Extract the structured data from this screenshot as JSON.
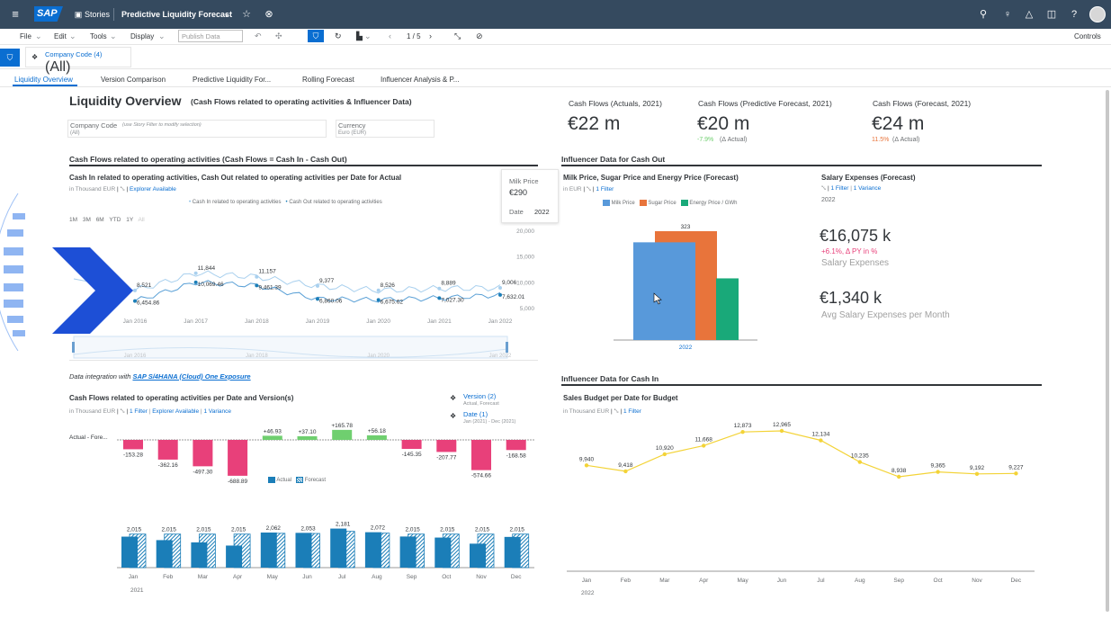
{
  "shell": {
    "logo": "SAP",
    "stories": "Stories",
    "story_title": "Predictive Liquidity Forecast"
  },
  "toolbar": {
    "file": "File",
    "edit": "Edit",
    "tools": "Tools",
    "display": "Display",
    "publish": "Publish Data",
    "page": "1 / 5",
    "controls": "Controls"
  },
  "filter": {
    "label": "Company Code (4)",
    "value": "(All)"
  },
  "tabs": [
    "Liquidity Overview",
    "Version Comparison",
    "Predictive Liquidity For...",
    "Rolling Forecast",
    "Influencer Analysis & P..."
  ],
  "page": {
    "title": "Liquidity Overview",
    "subtitle": "(Cash Flows related to operating activities & Influencer Data)",
    "company_code_label": "Company Code",
    "company_code_hint": "(use Story Filter to modify selection)",
    "company_code_value": "(All)",
    "currency_label": "Currency",
    "currency_value": "Euro (EUR)"
  },
  "kpis": [
    {
      "label": "Cash Flows (Actuals, 2021)",
      "value": "€22 m",
      "delta": "",
      "delta_label": ""
    },
    {
      "label": "Cash Flows (Predictive Forecast, 2021)",
      "value": "€20 m",
      "delta": "-7.9%",
      "delta_label": "(Δ Actual)"
    },
    {
      "label": "Cash Flows (Forecast, 2021)",
      "value": "€24 m",
      "delta": "11.5%",
      "delta_label": "(Δ Actual)"
    }
  ],
  "sections": {
    "cashflows": "Cash Flows related to operating activities (Cash Flows = Cash In - Cash Out)",
    "influencer_out": "Influencer Data for Cash Out",
    "influencer_in": "Influencer Data for Cash In"
  },
  "line_widget": {
    "title": "Cash In related to operating activities, Cash Out related to operating activities per Date for Actual",
    "sub_unit": "in Thousand EUR",
    "sub_link": "Explorer Available",
    "legend": [
      "Cash In related to operating activities",
      "Cash Out related to operating activities"
    ],
    "ranges": [
      "1M",
      "3M",
      "6M",
      "YTD",
      "1Y",
      "All"
    ],
    "tooltip": {
      "label1": "Milk Price",
      "value1": "€290",
      "label2": "Date",
      "value2": "2022"
    },
    "x_labels": [
      "Jan 2016",
      "Jan 2017",
      "Jan 2018",
      "Jan 2019",
      "Jan 2020",
      "Jan 2021",
      "Jan 2022"
    ],
    "y_labels": [
      "20,000",
      "15,000",
      "10,000",
      "5,000"
    ],
    "data_labels_in": [
      "8,521",
      "11,844",
      "11,157",
      "9,377",
      "8,526",
      "8,889",
      "9,006"
    ],
    "data_labels_out": [
      "6,454.86",
      "10,069.46",
      "9,461.39",
      "6,860.06",
      "6,675.62",
      "7,027.30",
      "7,632.01"
    ]
  },
  "integration": {
    "text": "Data integration with",
    "link": "SAP S/4HANA (Cloud) One Exposure"
  },
  "waterfall": {
    "title": "Cash Flows related to operating activities per Date and Version(s)",
    "sub_unit": "in Thousand EUR",
    "sub_filter": "1 Filter",
    "sub_explorer": "Explorer Available",
    "sub_variance": "1 Variance",
    "row_label": "Actual - Fore...",
    "version_label": "Version (2)",
    "version_value": "Actual, Forecast",
    "date_label": "Date (1)",
    "date_value": "Jan (2021) - Dec (2021)",
    "legend": [
      "Actual",
      "Forecast"
    ],
    "year": "2021"
  },
  "chart_data": [
    {
      "type": "line",
      "title": "Cash In related to operating activities, Cash Out related to operating activities per Date for Actual",
      "x": [
        "2016",
        "2017",
        "2018",
        "2019",
        "2020",
        "2021",
        "2022"
      ],
      "series": [
        {
          "name": "Cash In related to operating activities",
          "values": [
            8521,
            11844,
            11157,
            9377,
            8526,
            8889,
            9006
          ]
        },
        {
          "name": "Cash Out related to operating activities",
          "values": [
            6454.86,
            10069.46,
            9461.39,
            6860.06,
            6675.62,
            7027.3,
            7632.01
          ]
        }
      ],
      "ylim": [
        5000,
        20000
      ]
    },
    {
      "type": "bar",
      "title": "Cash Flows related to operating activities per Date and Version(s)",
      "categories": [
        "Jan",
        "Feb",
        "Mar",
        "Apr",
        "May",
        "Jun",
        "Jul",
        "Aug",
        "Sep",
        "Oct",
        "Nov",
        "Dec"
      ],
      "variance": [
        -153.28,
        -362.16,
        -497.3,
        -688.89,
        46.93,
        37.1,
        165.78,
        56.18,
        -145.35,
        -207.77,
        -574.66,
        -168.58
      ],
      "variance_labels": [
        "-153.28",
        "-362.16",
        "-497.30",
        "-688.89",
        "+46.93",
        "+37.10",
        "+165.78",
        "+56.18",
        "-145.35",
        "-207.77",
        "-574.66",
        "-168.58"
      ],
      "series": [
        {
          "name": "Actual",
          "values": [
            1862,
            1653,
            1518,
            1326,
            2109,
            2090,
            2347,
            2128,
            1870,
            1807,
            1440,
            1846
          ]
        },
        {
          "name": "Forecast",
          "values": [
            2015,
            2015,
            2015,
            2015,
            2062,
            2053,
            2181,
            2072,
            2015,
            2015,
            2015,
            2015
          ]
        }
      ],
      "top_labels": [
        "2,015",
        "2,015",
        "2,015",
        "2,015",
        "2,062",
        "2,053",
        "2,181",
        "2,072",
        "2,015",
        "2,015",
        "2,015",
        "2,015"
      ]
    },
    {
      "type": "bar",
      "title": "Milk Price, Sugar Price and Energy Price (Forecast)",
      "categories": [
        "2022"
      ],
      "series": [
        {
          "name": "Milk Price",
          "values": 290
        },
        {
          "name": "Sugar Price",
          "values": 323
        },
        {
          "name": "Energy Price / GWh",
          "values": 183
        }
      ],
      "top_label": "323"
    },
    {
      "type": "line",
      "title": "Sales Budget per Date for Budget",
      "categories": [
        "Jan",
        "Feb",
        "Mar",
        "Apr",
        "May",
        "Jun",
        "Jul",
        "Aug",
        "Sep",
        "Oct",
        "Nov",
        "Dec"
      ],
      "values": [
        9940,
        9418,
        10920,
        11668,
        12873,
        12965,
        12134,
        10235,
        8938,
        9365,
        9192,
        9227
      ],
      "labels": [
        "9,940",
        "9,418",
        "10,920",
        "11,668",
        "12,873",
        "12,965",
        "12,134",
        "10,235",
        "8,938",
        "9,365",
        "9,192",
        "9,227"
      ],
      "year": "2022"
    }
  ],
  "milk_widget": {
    "title": "Milk Price, Sugar Price and Energy Price (Forecast)",
    "sub_unit": "in EUR",
    "sub_filter": "1 Filter",
    "legend": [
      "Milk Price",
      "Sugar Price",
      "Energy Price / GWh"
    ],
    "x": "2022",
    "top": "323"
  },
  "salary": {
    "title": "Salary Expenses (Forecast)",
    "filter": "1 Filter",
    "variance": "1 Variance",
    "year": "2022",
    "value1": "€16,075 k",
    "delta": "+6.1%, Δ PY in %",
    "label1": "Salary Expenses",
    "value2": "€1,340 k",
    "label2": "Avg Salary Expenses per Month"
  },
  "sales": {
    "title": "Sales Budget per Date for Budget",
    "sub_unit": "in Thousand EUR",
    "sub_filter": "1 Filter",
    "year": "2022"
  },
  "colors": {
    "shell": "#354a5f",
    "accent": "#0a6ed1",
    "milk": "#5899da",
    "sugar": "#e8743b",
    "energy": "#19a979",
    "actual": "#1b7eb8",
    "neg": "#e8407a",
    "pos": "#6fcf6f",
    "line": "#f3d337",
    "overlay": "#1d4fd6"
  }
}
